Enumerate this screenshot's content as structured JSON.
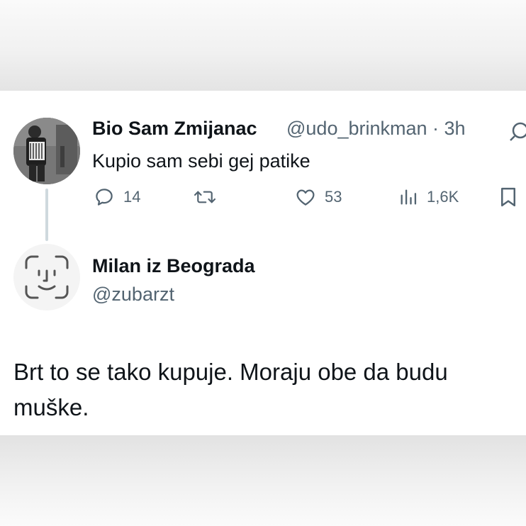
{
  "tweet": {
    "author_name": "Bio Sam Zmijanac",
    "handle_time": "@udo_brinkman · 3h",
    "text": "Kupio sam sebi gej patike",
    "stats": {
      "replies": "14",
      "likes": "53",
      "views": "1,6K"
    }
  },
  "reply": {
    "author_name": "Milan iz Beograda",
    "handle": "@zubarzt",
    "text": "Brt to se tako kupuje. Moraju obe da budu muške."
  },
  "colors": {
    "text_primary": "#0f1419",
    "text_secondary": "#536471",
    "thread_line": "#cfd9de"
  },
  "icons": [
    "reply-icon",
    "retweet-icon",
    "like-icon",
    "views-icon",
    "bookmark-icon",
    "more-icon"
  ]
}
